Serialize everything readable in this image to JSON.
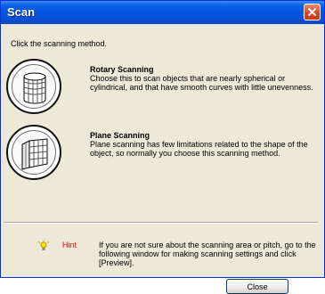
{
  "window": {
    "title": "Scan"
  },
  "instruction": "Click the scanning method.",
  "options": [
    {
      "title": "Rotary Scanning",
      "description": "Choose this to scan objects that are nearly spherical or cylindrical, and that have smooth curves with little unevenness.",
      "icon": "cylinder-icon"
    },
    {
      "title": "Plane Scanning",
      "description": "Plane scanning has few limitations related to the shape of the object, so normally you choose this scanning method.",
      "icon": "plane-icon"
    }
  ],
  "hint": {
    "label": "Hint",
    "text": "If you are not sure about the scanning area or pitch, go to the following window for making scanning settings and click [Preview].",
    "icon": "lightbulb-icon"
  },
  "buttons": {
    "close": "Close"
  },
  "colors": {
    "titlebar": "#0554e1",
    "close_button": "#d4441f",
    "hint_label": "#ff0000",
    "dialog_bg": "#ece9d8"
  }
}
